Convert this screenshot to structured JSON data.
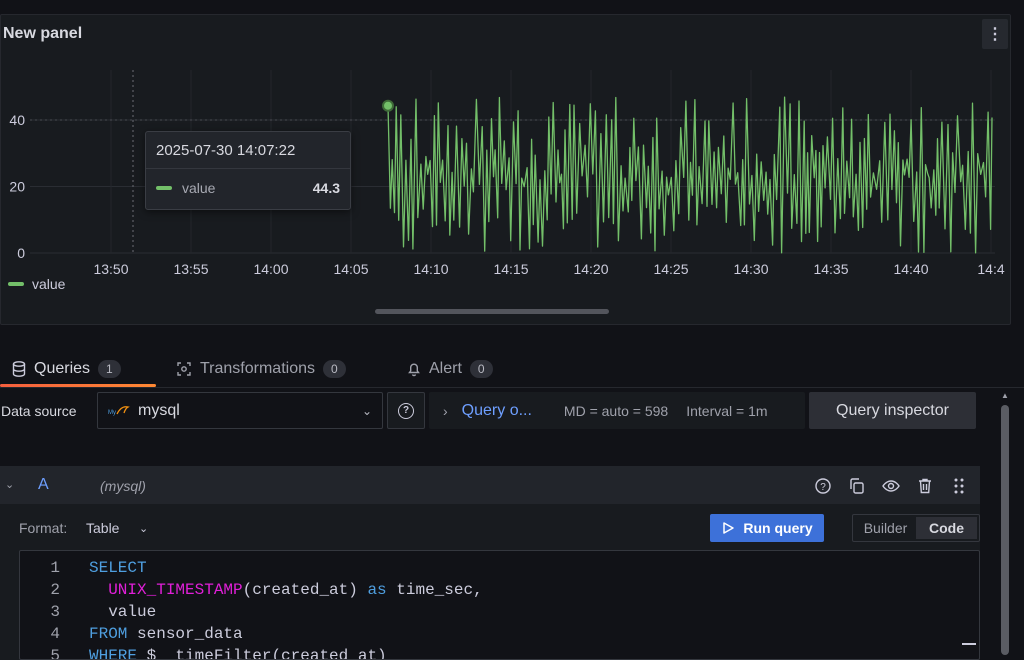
{
  "panel": {
    "title": "New panel",
    "menu_icon": "vertical-dots-icon"
  },
  "chart_data": {
    "type": "line",
    "y_ticks": [
      "0",
      "20",
      "40"
    ],
    "ylim": [
      0,
      50
    ],
    "x_ticks": [
      "13:50",
      "13:55",
      "14:00",
      "14:05",
      "14:10",
      "14:15",
      "14:20",
      "14:25",
      "14:30",
      "14:35",
      "14:40",
      "14:4"
    ],
    "series": [
      {
        "name": "value",
        "color": "#73bf69",
        "first_visible_value": 44.3
      }
    ],
    "data_start": "14:07:22",
    "grid": true
  },
  "legend": {
    "items": [
      "value"
    ]
  },
  "tooltip": {
    "time": "2025-07-30 14:07:22",
    "series": "value",
    "value": "44.3"
  },
  "tabs": [
    {
      "label": "Queries",
      "count": "1",
      "icon": "database-icon"
    },
    {
      "label": "Transformations",
      "count": "0",
      "icon": "transform-icon"
    },
    {
      "label": "Alert",
      "count": "0",
      "icon": "bell-icon"
    }
  ],
  "datasource": {
    "label": "Data source",
    "name": "mysql"
  },
  "query_options": {
    "title": "Query o...",
    "md": "MD = auto = 598",
    "interval": "Interval = 1m"
  },
  "query_inspector": "Query inspector",
  "query": {
    "ref_id": "A",
    "datasource_hint": "(mysql)",
    "format_label": "Format:",
    "format_value": "Table",
    "run_label": "Run query",
    "modes": [
      "Builder",
      "Code"
    ],
    "active_mode": "Code"
  },
  "code_lines": [
    {
      "n": "1",
      "parts": [
        {
          "t": "kw",
          "v": "SELECT"
        }
      ]
    },
    {
      "n": "2",
      "parts": [
        {
          "t": "tx",
          "v": "  "
        },
        {
          "t": "fn",
          "v": "UNIX_TIMESTAMP"
        },
        {
          "t": "tx",
          "v": "(created_at) "
        },
        {
          "t": "kw",
          "v": "as"
        },
        {
          "t": "tx",
          "v": " time_sec,"
        }
      ]
    },
    {
      "n": "3",
      "parts": [
        {
          "t": "tx",
          "v": "  value"
        }
      ]
    },
    {
      "n": "4",
      "parts": [
        {
          "t": "kw",
          "v": "FROM"
        },
        {
          "t": "tx",
          "v": " sensor_data"
        }
      ]
    },
    {
      "n": "5",
      "parts": [
        {
          "t": "kw",
          "v": "WHERE"
        },
        {
          "t": "tx",
          "v": " $__timeFilter(created_at)"
        }
      ]
    }
  ]
}
